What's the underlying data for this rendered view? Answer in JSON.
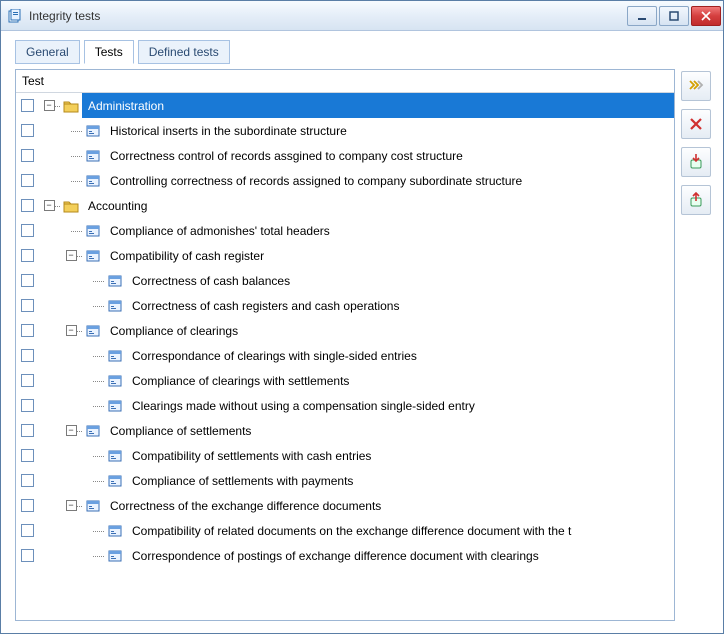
{
  "window": {
    "title": "Integrity tests"
  },
  "tabs": {
    "general": "General",
    "tests": "Tests",
    "defined": "Defined tests",
    "active_index": 1
  },
  "tree": {
    "header": "Test",
    "rows": [
      {
        "depth": 0,
        "expander": "minus",
        "icon": "folder",
        "label": "Administration",
        "selected": true
      },
      {
        "depth": 1,
        "expander": null,
        "icon": "doc",
        "label": "Historical inserts in the subordinate structure"
      },
      {
        "depth": 1,
        "expander": null,
        "icon": "doc",
        "label": "Correctness control of records assgined to company cost structure"
      },
      {
        "depth": 1,
        "expander": null,
        "icon": "doc",
        "label": "Controlling correctness of records assigned to company subordinate structure",
        "last_in_branch": true
      },
      {
        "depth": 0,
        "expander": "minus",
        "icon": "folder",
        "label": "Accounting"
      },
      {
        "depth": 1,
        "expander": null,
        "icon": "doc",
        "label": "Compliance of admonishes' total headers"
      },
      {
        "depth": 1,
        "expander": "minus",
        "icon": "doc",
        "label": "Compatibility of cash register"
      },
      {
        "depth": 2,
        "expander": null,
        "icon": "doc",
        "label": "Correctness of cash balances"
      },
      {
        "depth": 2,
        "expander": null,
        "icon": "doc",
        "label": "Correctness of cash registers and cash operations",
        "last_in_branch": true
      },
      {
        "depth": 1,
        "expander": "minus",
        "icon": "doc",
        "label": "Compliance of clearings"
      },
      {
        "depth": 2,
        "expander": null,
        "icon": "doc",
        "label": "Correspondance of clearings with single-sided entries"
      },
      {
        "depth": 2,
        "expander": null,
        "icon": "doc",
        "label": "Compliance of clearings with settlements"
      },
      {
        "depth": 2,
        "expander": null,
        "icon": "doc",
        "label": "Clearings made without using a compensation single-sided entry",
        "last_in_branch": true
      },
      {
        "depth": 1,
        "expander": "minus",
        "icon": "doc",
        "label": "Compliance of settlements"
      },
      {
        "depth": 2,
        "expander": null,
        "icon": "doc",
        "label": "Compatibility of settlements with cash entries"
      },
      {
        "depth": 2,
        "expander": null,
        "icon": "doc",
        "label": "Compliance of settlements with payments",
        "last_in_branch": true
      },
      {
        "depth": 1,
        "expander": "minus",
        "icon": "doc",
        "label": "Correctness of the exchange difference documents"
      },
      {
        "depth": 2,
        "expander": null,
        "icon": "doc",
        "label": "Compatibility of related documents on the exchange difference document with the t"
      },
      {
        "depth": 2,
        "expander": null,
        "icon": "doc",
        "label": "Correspondence of postings of exchange difference document with clearings",
        "last_in_branch": true
      }
    ]
  },
  "sidebar": {
    "buttons": [
      "run-icon",
      "delete-icon",
      "import-icon",
      "export-icon"
    ]
  },
  "colors": {
    "selection": "#1979d6"
  }
}
